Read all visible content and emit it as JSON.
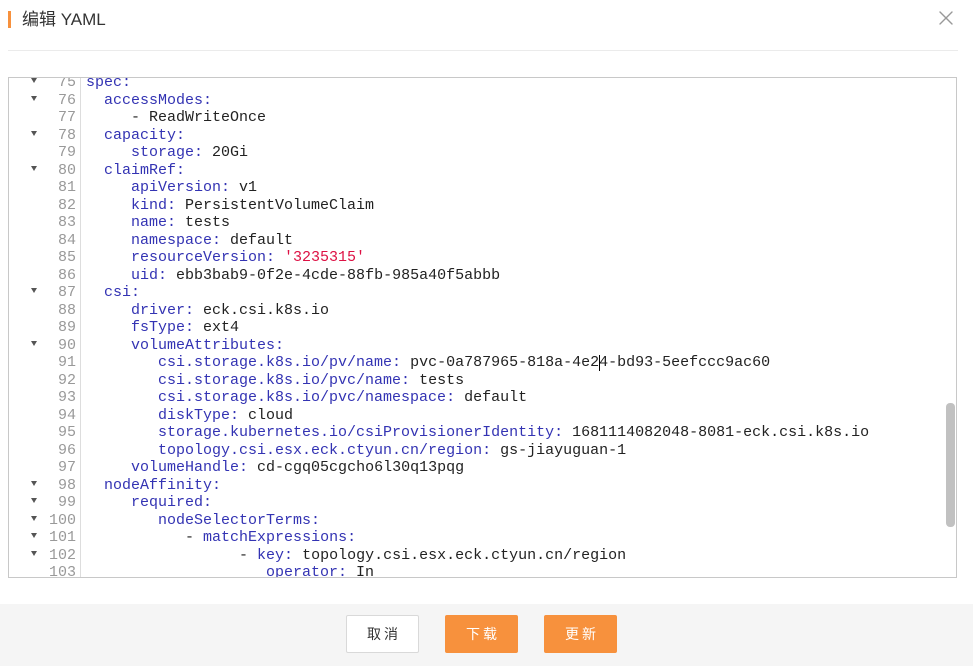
{
  "dialog": {
    "title": "编辑 YAML",
    "close_icon": "close-icon"
  },
  "editor": {
    "fold_icon": "fold-arrow-icon",
    "lines": [
      {
        "num": 75,
        "fold": true,
        "text": "spec:"
      },
      {
        "num": 76,
        "fold": true,
        "text": "  accessModes:"
      },
      {
        "num": 77,
        "fold": false,
        "text": "     - ReadWriteOnce"
      },
      {
        "num": 78,
        "fold": true,
        "text": "  capacity:"
      },
      {
        "num": 79,
        "fold": false,
        "text": "     storage: 20Gi"
      },
      {
        "num": 80,
        "fold": true,
        "text": "  claimRef:"
      },
      {
        "num": 81,
        "fold": false,
        "text": "     apiVersion: v1"
      },
      {
        "num": 82,
        "fold": false,
        "text": "     kind: PersistentVolumeClaim"
      },
      {
        "num": 83,
        "fold": false,
        "text": "     name: tests"
      },
      {
        "num": 84,
        "fold": false,
        "text": "     namespace: default"
      },
      {
        "num": 85,
        "fold": false,
        "text": "     resourceVersion: '3235315'"
      },
      {
        "num": 86,
        "fold": false,
        "text": "     uid: ebb3bab9-0f2e-4cde-88fb-985a40f5abbb"
      },
      {
        "num": 87,
        "fold": true,
        "text": "  csi:"
      },
      {
        "num": 88,
        "fold": false,
        "text": "     driver: eck.csi.k8s.io"
      },
      {
        "num": 89,
        "fold": false,
        "text": "     fsType: ext4"
      },
      {
        "num": 90,
        "fold": true,
        "text": "     volumeAttributes:"
      },
      {
        "num": 91,
        "fold": false,
        "text": "        csi.storage.k8s.io/pv/name: pvc-0a787965-818a-4e24-bd93-5eefccc9ac60"
      },
      {
        "num": 92,
        "fold": false,
        "text": "        csi.storage.k8s.io/pvc/name: tests"
      },
      {
        "num": 93,
        "fold": false,
        "text": "        csi.storage.k8s.io/pvc/namespace: default"
      },
      {
        "num": 94,
        "fold": false,
        "text": "        diskType: cloud"
      },
      {
        "num": 95,
        "fold": false,
        "text": "        storage.kubernetes.io/csiProvisionerIdentity: 1681114082048-8081-eck.csi.k8s.io"
      },
      {
        "num": 96,
        "fold": false,
        "text": "        topology.csi.esx.eck.ctyun.cn/region: gs-jiayuguan-1"
      },
      {
        "num": 97,
        "fold": false,
        "text": "     volumeHandle: cd-cgq05cgcho6l30q13pqg"
      },
      {
        "num": 98,
        "fold": true,
        "text": "  nodeAffinity:"
      },
      {
        "num": 99,
        "fold": true,
        "text": "     required:"
      },
      {
        "num": 100,
        "fold": true,
        "text": "        nodeSelectorTerms:"
      },
      {
        "num": 101,
        "fold": true,
        "text": "           - matchExpressions:"
      },
      {
        "num": 102,
        "fold": true,
        "text": "                 - key: topology.csi.esx.eck.ctyun.cn/region"
      },
      {
        "num": 103,
        "fold": false,
        "text": "                    operator: In"
      }
    ]
  },
  "footer": {
    "cancel_label": "取消",
    "download_label": "下载",
    "update_label": "更新"
  },
  "colors": {
    "accent": "#f7913d",
    "yaml_key": "#3333b3",
    "yaml_value": "#222222",
    "yaml_string": "#dd1144",
    "line_number": "#999999"
  }
}
